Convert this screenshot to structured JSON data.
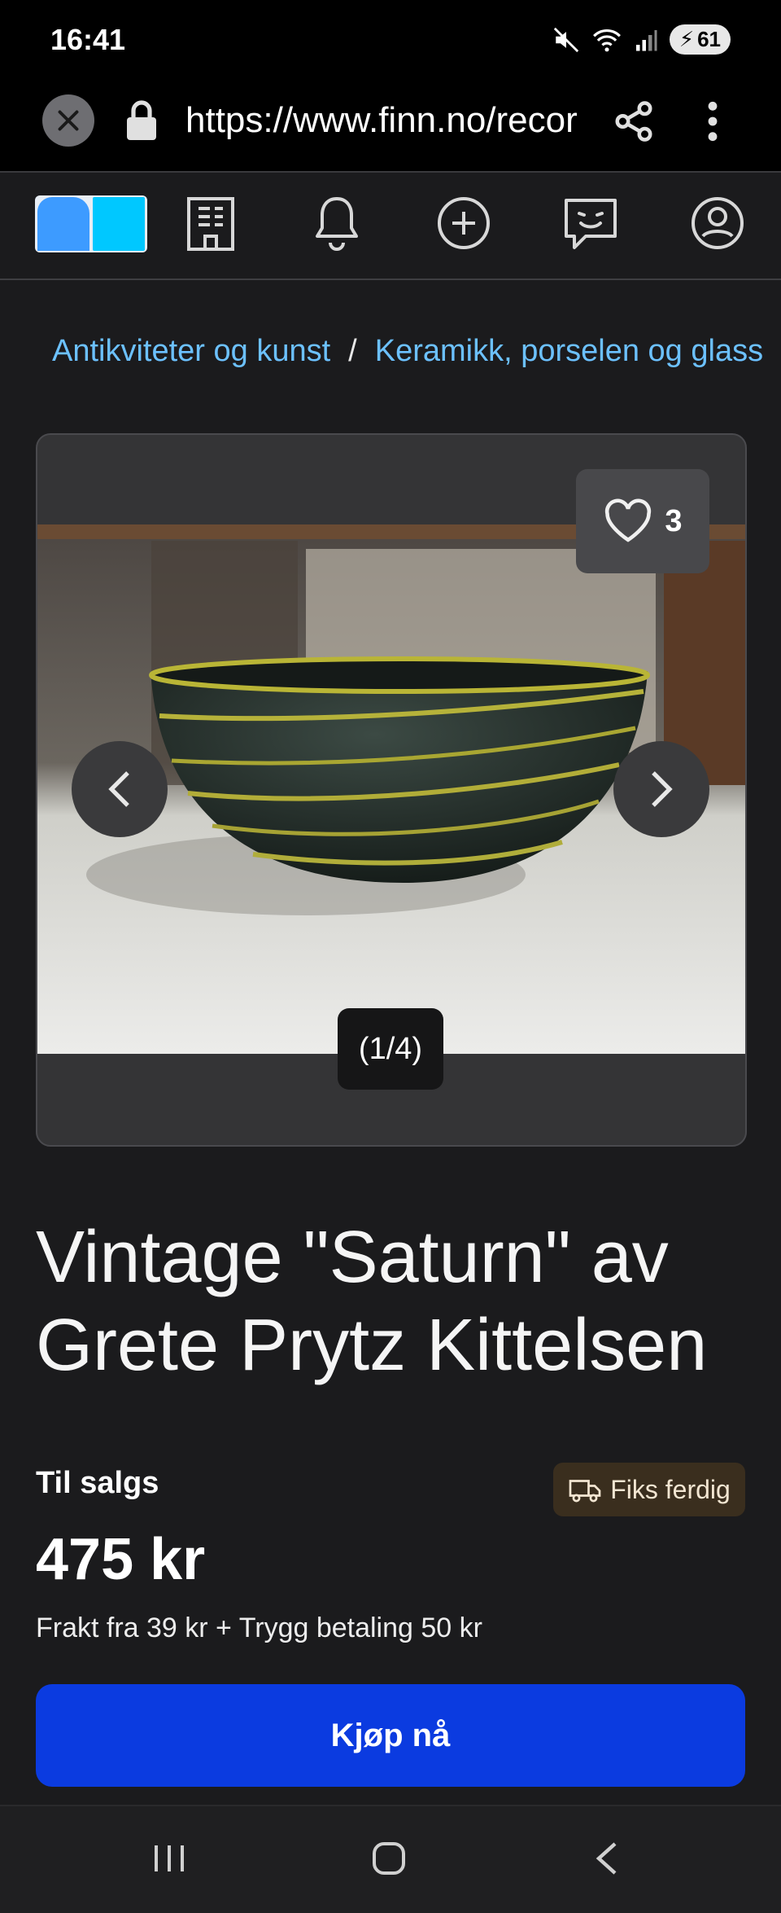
{
  "status": {
    "time": "16:41",
    "battery": "61"
  },
  "browser": {
    "url": "https://www.finn.no/recor"
  },
  "breadcrumb": {
    "items": [
      "Antikviteter og kunst",
      "Keramikk, porselen og glass"
    ],
    "separator": "/"
  },
  "gallery": {
    "favorites_count": "3",
    "counter": "(1/4)"
  },
  "listing": {
    "title": "Vintage \"Saturn\" av Grete Prytz Kittelsen",
    "status": "Til salgs",
    "badge": "Fiks ferdig",
    "price": "475 kr",
    "shipping": "Frakt fra 39 kr + Trygg betaling 50 kr",
    "buy_label": "Kjøp nå"
  },
  "colors": {
    "link": "#6cc1ff",
    "buy": "#0b3be0",
    "logo_left": "#3d9bff",
    "logo_right": "#00c8ff"
  },
  "icons": [
    "close-icon",
    "lock-icon",
    "share-icon",
    "more-icon",
    "finn-logo",
    "building-icon",
    "bell-icon",
    "plus-icon",
    "chat-icon",
    "profile-icon",
    "heart-icon",
    "chevron-left-icon",
    "chevron-right-icon",
    "truck-icon",
    "recents-icon",
    "home-icon",
    "back-icon"
  ]
}
